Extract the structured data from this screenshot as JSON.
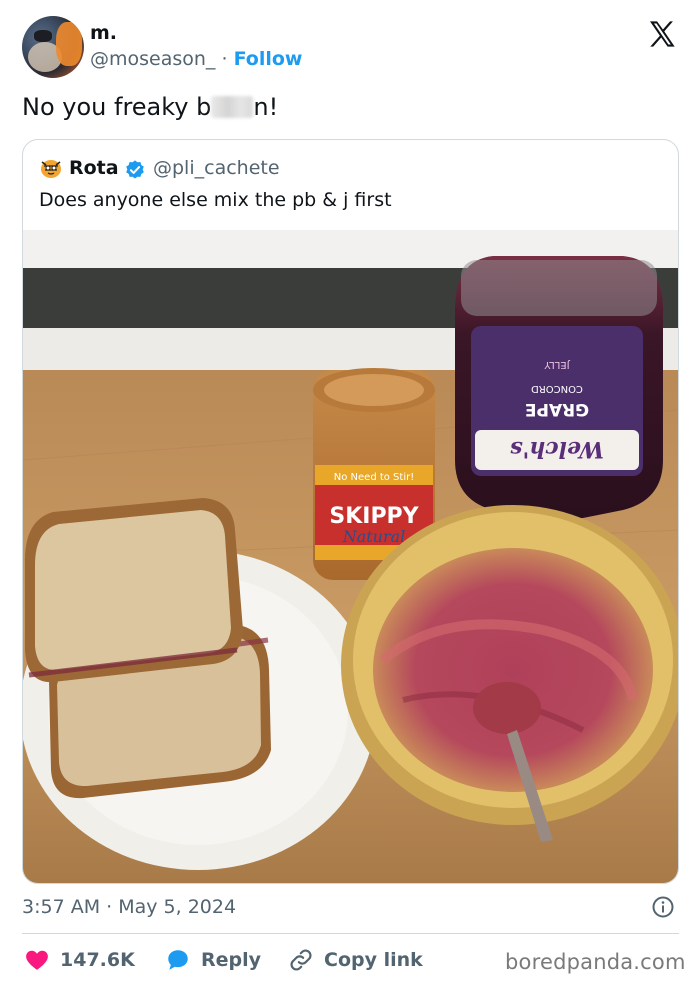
{
  "author": {
    "name": "m.",
    "handle": "@moseason_",
    "separator": "·",
    "follow_label": "Follow"
  },
  "tweet": {
    "text_before": "No you freaky b",
    "text_after": "n!"
  },
  "quoted": {
    "name": "Rota",
    "handle": "@pli_cachete",
    "text": "Does anyone else mix the pb & j first",
    "photo_labels": {
      "jar_brand": "SKIPPY",
      "jar_tagline": "No Need to Stir!",
      "jar_sub": "Natural",
      "bottle_brand": "Welch's",
      "bottle_line1": "CONCORD",
      "bottle_line2": "GRAPE",
      "bottle_line3": "JELLY"
    }
  },
  "footer": {
    "timestamp": "3:57 AM · May 5, 2024",
    "likes_count": "147.6K",
    "reply_label": "Reply",
    "copy_link_label": "Copy link"
  },
  "watermark": "boredpanda.com",
  "colors": {
    "accent": "#1d9bf0",
    "like": "#f91880",
    "secondary_text": "#536471",
    "border": "#cfd9de"
  },
  "icons": {
    "platform": "x-logo-icon",
    "verified": "verified-badge-icon",
    "info": "info-icon",
    "like": "heart-icon",
    "reply": "speech-bubble-icon",
    "copy": "link-icon"
  }
}
